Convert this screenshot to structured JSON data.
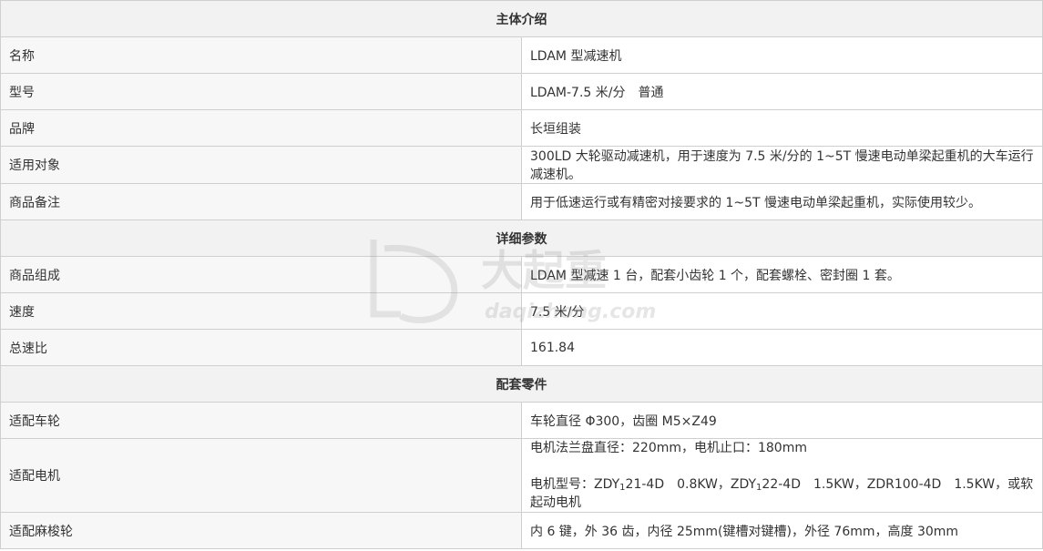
{
  "sections": {
    "intro": "主体介绍",
    "detail": "详细参数",
    "parts": "配套零件"
  },
  "intro_rows": [
    {
      "label": "名称",
      "value": "LDAM 型减速机"
    },
    {
      "label": "型号",
      "value": "LDAM-7.5 米/分　普通"
    },
    {
      "label": "品牌",
      "value": "长垣组装"
    },
    {
      "label": "适用对象",
      "value": "300LD 大轮驱动减速机，用于速度为 7.5 米/分的 1~5T 慢速电动单梁起重机的大车运行减速机。"
    },
    {
      "label": "商品备注",
      "value": "用于低速运行或有精密对接要求的 1~5T 慢速电动单梁起重机，实际使用较少。"
    }
  ],
  "detail_rows": [
    {
      "label": "商品组成",
      "value": "LDAM 型减速 1 台，配套小齿轮 1 个，配套螺栓、密封圈 1 套。"
    },
    {
      "label": "速度",
      "value": "7.5 米/分"
    },
    {
      "label": "总速比",
      "value": "161.84"
    }
  ],
  "parts": {
    "wheel": {
      "label": "适配车轮",
      "value": "车轮直径 Φ300，齿圈 M5×Z49"
    },
    "motor": {
      "label": "适配电机",
      "line1": "电机法兰盘直径：220mm，电机止口：180mm",
      "line2": {
        "a": "电机型号：ZDY",
        "s1": "1",
        "b": "21-4D　0.8KW，ZDY",
        "s2": "1",
        "c": "22-4D　1.5KW，ZDR100-4D　1.5KW，或软起动电机"
      }
    },
    "roller": {
      "label": "适配麻梭轮",
      "value": "内 6 键，外 36 齿，内径 25mm(键槽对键槽)，外径 76mm，高度 30mm"
    }
  },
  "watermark": {
    "brand": "大起重",
    "domain": "daqizhong.com"
  }
}
